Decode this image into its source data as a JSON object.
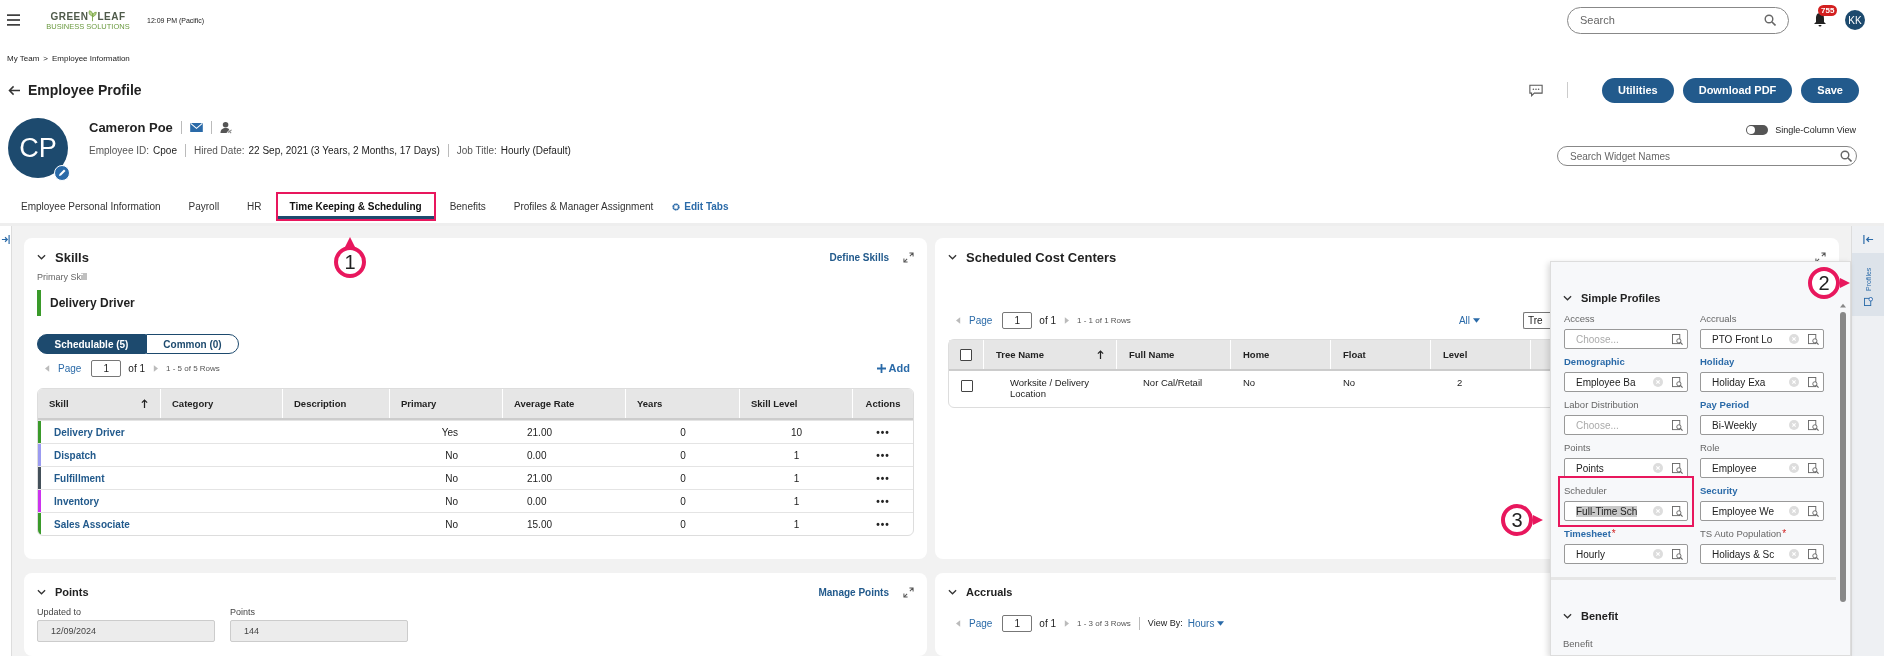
{
  "header": {
    "logo_words": [
      "GREEN",
      "LEAF"
    ],
    "logo_tagline": "BUSINESS SOLUTIONS",
    "time": "12:09 PM (Pacific)",
    "search": {
      "placeholder": "Search"
    },
    "notifications": "755",
    "user_initials": "KK"
  },
  "breadcrumb": {
    "items": [
      "My Team",
      "Employee Information"
    ],
    "separator": ">"
  },
  "page_title": "Employee Profile",
  "actions": [
    "Utilities",
    "Download PDF",
    "Save"
  ],
  "single_column_view": {
    "label": "Single-Column View",
    "on": false
  },
  "widget_search": {
    "placeholder": "Search Widget Names"
  },
  "employee": {
    "initials": "CP",
    "name": "Cameron Poe",
    "details": [
      {
        "label": "Employee ID:",
        "value": "Cpoe"
      },
      {
        "label": "Hired Date:",
        "value": "22 Sep, 2021 (3 Years, 2 Months, 17 Days)"
      },
      {
        "label": "Job Title:",
        "value": "Hourly (Default)"
      }
    ]
  },
  "tabs": [
    {
      "label": "Employee Personal Information",
      "selected": false,
      "highlighted": false
    },
    {
      "label": "Payroll",
      "selected": false,
      "highlighted": false
    },
    {
      "label": "HR",
      "selected": false,
      "highlighted": false
    },
    {
      "label": "Time Keeping & Scheduling",
      "selected": true,
      "highlighted": true
    },
    {
      "label": "Benefits",
      "selected": false,
      "highlighted": false
    },
    {
      "label": "Profiles & Manager Assignment",
      "selected": false,
      "highlighted": false
    }
  ],
  "edit_tabs": "Edit Tabs",
  "skills": {
    "title": "Skills",
    "link": "Define Skills",
    "primary_label": "Primary Skill",
    "primary_skill": {
      "name": "Delivery Driver",
      "color": "#3a9a2a"
    },
    "segments": [
      {
        "label": "Schedulable (5)",
        "selected": true
      },
      {
        "label": "Common (0)",
        "selected": false
      }
    ],
    "pager": {
      "label": "Page",
      "page": "1",
      "of": "of 1",
      "rows": "1 - 5 of 5 Rows"
    },
    "add": "Add",
    "columns": [
      {
        "label": "Skill",
        "sorted": true
      },
      {
        "label": "Category",
        "sorted": false
      },
      {
        "label": "Description",
        "sorted": false
      },
      {
        "label": "Primary",
        "sorted": false
      },
      {
        "label": "Average Rate",
        "sorted": false
      },
      {
        "label": "Years",
        "sorted": false
      },
      {
        "label": "Skill Level",
        "sorted": false
      },
      {
        "label": "Actions",
        "sorted": false
      }
    ],
    "rows": [
      {
        "color": "#3a9a2a",
        "skill": "Delivery Driver",
        "primary": "Yes",
        "rate": "21.00",
        "years": "0",
        "level": "10",
        "actions": "•••"
      },
      {
        "color": "#9b9bf0",
        "skill": "Dispatch",
        "primary": "No",
        "rate": "0.00",
        "years": "0",
        "level": "1",
        "actions": "•••"
      },
      {
        "color": "#44505a",
        "skill": "Fulfillment",
        "primary": "No",
        "rate": "21.00",
        "years": "0",
        "level": "1",
        "actions": "•••"
      },
      {
        "color": "#cc33ee",
        "skill": "Inventory",
        "primary": "No",
        "rate": "0.00",
        "years": "0",
        "level": "1",
        "actions": "•••"
      },
      {
        "color": "#3a9a2a",
        "skill": "Sales Associate",
        "primary": "No",
        "rate": "15.00",
        "years": "0",
        "level": "1",
        "actions": "•••"
      }
    ]
  },
  "cost_centers": {
    "title": "Scheduled Cost Centers",
    "pager": {
      "label": "Page",
      "page": "1",
      "of": "of 1",
      "rows": "1 - 1 of 1 Rows"
    },
    "filter": "All",
    "tree_select": "Tre",
    "columns": [
      {
        "label": "Tree Name",
        "sorted": true
      },
      {
        "label": "Full Name",
        "sorted": false
      },
      {
        "label": "Home",
        "sorted": false
      },
      {
        "label": "Float",
        "sorted": false
      },
      {
        "label": "Level",
        "sorted": false
      }
    ],
    "header_checked": false,
    "rows": [
      {
        "checked": false,
        "cells": [
          "Worksite / Delivery Location",
          "Nor Cal/Retail",
          "No",
          "No",
          "2"
        ]
      }
    ]
  },
  "profiles_panel": {
    "title": "Simple Profiles",
    "fields": [
      {
        "label": "Access",
        "emphasized": false,
        "placeholder": "Choose..."
      },
      {
        "label": "Accruals",
        "emphasized": false,
        "value": "PTO Front Lo"
      },
      {
        "label": "Demographic",
        "emphasized": true,
        "value": "Employee Ba"
      },
      {
        "label": "Holiday",
        "emphasized": true,
        "value": "Holiday Exa"
      },
      {
        "label": "Labor Distribution",
        "emphasized": false,
        "placeholder": "Choose..."
      },
      {
        "label": "Pay Period",
        "emphasized": true,
        "value": "Bi-Weekly"
      },
      {
        "label": "Points",
        "emphasized": false,
        "value": "Points"
      },
      {
        "label": "Role",
        "emphasized": false,
        "value": "Employee"
      },
      {
        "label": "Scheduler",
        "emphasized": false,
        "value": "Full-Time Sch",
        "text_selected": true,
        "highlighted": true
      },
      {
        "label": "Security",
        "emphasized": true,
        "value": "Employee We"
      },
      {
        "label": "Timesheet",
        "emphasized": true,
        "required_mark": "*",
        "value": "Hourly"
      },
      {
        "label": "TS Auto Population",
        "emphasized": false,
        "required_mark": "*",
        "value": "Holidays & Sc"
      }
    ],
    "section2": "Benefit",
    "section2_field": "Benefit"
  },
  "right_rail": {
    "label": "Profiles"
  },
  "points": {
    "title": "Points",
    "link": "Manage Points",
    "fields": [
      {
        "label": "Updated to",
        "value": "12/09/2024"
      },
      {
        "label": "Points",
        "value": "144"
      }
    ]
  },
  "accruals": {
    "title": "Accruals",
    "pager": {
      "label": "Page",
      "page": "1",
      "of": "of 1",
      "rows": "1 - 3 of 3 Rows"
    },
    "view_by": "View By:",
    "view_value": "Hours"
  },
  "callouts": [
    {
      "number": "1"
    },
    {
      "number": "2"
    },
    {
      "number": "3"
    }
  ]
}
